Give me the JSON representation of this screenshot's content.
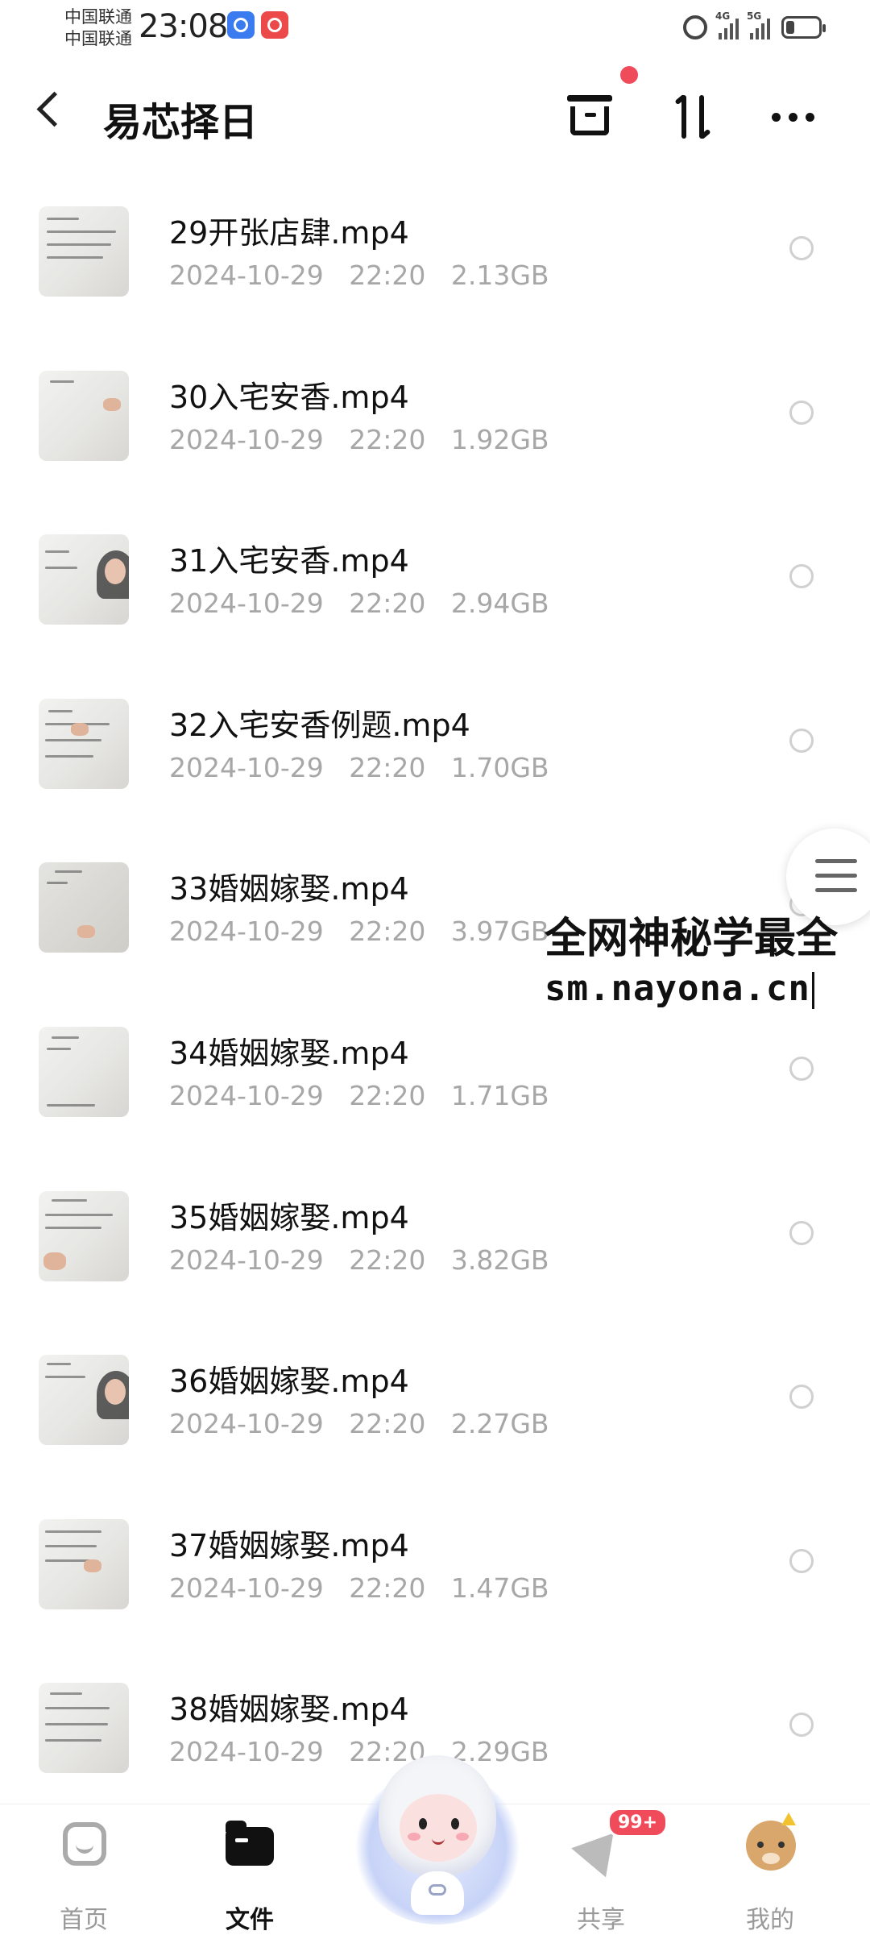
{
  "status_bar": {
    "carrier_1": "中国联通",
    "carrier_2": "中国联通",
    "time": "23:08",
    "net_1": "4G",
    "net_2": "5G"
  },
  "header": {
    "title": "易芯择日",
    "back_icon": "chevron-left-icon",
    "actions": [
      "box-icon",
      "sort-icon",
      "more-icon"
    ]
  },
  "files": [
    {
      "name": "29开张店肆.mp4",
      "date": "2024-10-29",
      "time": "22:20",
      "size": "2.13GB"
    },
    {
      "name": "30入宅安香.mp4",
      "date": "2024-10-29",
      "time": "22:20",
      "size": "1.92GB"
    },
    {
      "name": "31入宅安香.mp4",
      "date": "2024-10-29",
      "time": "22:20",
      "size": "2.94GB"
    },
    {
      "name": "32入宅安香例题.mp4",
      "date": "2024-10-29",
      "time": "22:20",
      "size": "1.70GB"
    },
    {
      "name": "33婚姻嫁娶.mp4",
      "date": "2024-10-29",
      "time": "22:20",
      "size": "3.97GB"
    },
    {
      "name": "34婚姻嫁娶.mp4",
      "date": "2024-10-29",
      "time": "22:20",
      "size": "1.71GB"
    },
    {
      "name": "35婚姻嫁娶.mp4",
      "date": "2024-10-29",
      "time": "22:20",
      "size": "3.82GB"
    },
    {
      "name": "36婚姻嫁娶.mp4",
      "date": "2024-10-29",
      "time": "22:20",
      "size": "2.27GB"
    },
    {
      "name": "37婚姻嫁娶.mp4",
      "date": "2024-10-29",
      "time": "22:20",
      "size": "1.47GB"
    },
    {
      "name": "38婚姻嫁娶.mp4",
      "date": "2024-10-29",
      "time": "22:20",
      "size": "2.29GB"
    }
  ],
  "watermark": {
    "line1": "全网神秘学最全",
    "line2": "sm.nayona.cn"
  },
  "tabbar": {
    "tabs": [
      {
        "label": "首页",
        "icon": "home-icon"
      },
      {
        "label": "文件",
        "icon": "folder-icon"
      },
      {
        "label": "共享",
        "icon": "share-icon"
      },
      {
        "label": "我的",
        "icon": "profile-icon"
      }
    ],
    "active": "文件",
    "share_badge": "99+"
  },
  "colors": {
    "accent_red": "#f04b5b",
    "meta_gray": "#a7a7a7"
  }
}
